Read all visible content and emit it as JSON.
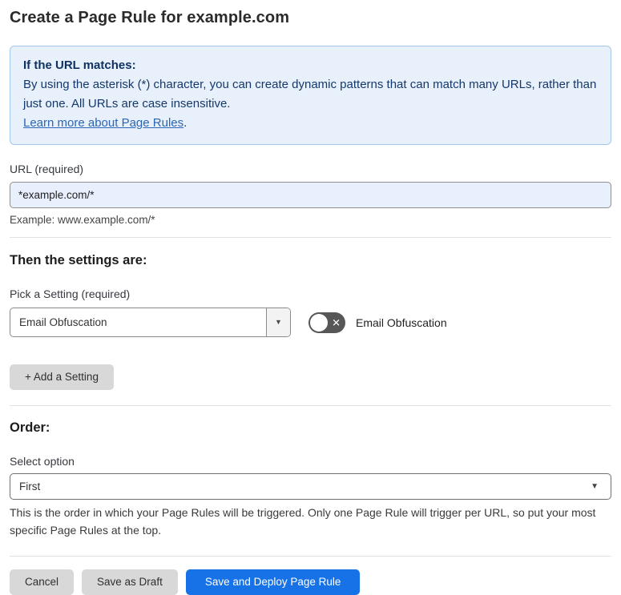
{
  "page": {
    "title": "Create a Page Rule for example.com"
  },
  "info_box": {
    "heading": "If the URL matches:",
    "body": "By using the asterisk (*) character, you can create dynamic patterns that can match many URLs, rather than just one. All URLs are case insensitive.",
    "link_label": "Learn more about Page Rules",
    "link_suffix": "."
  },
  "url_section": {
    "label": "URL (required)",
    "value": "*example.com/*",
    "example": "Example: www.example.com/*"
  },
  "settings_section": {
    "heading": "Then the settings are:",
    "picker_label": "Pick a Setting (required)",
    "selected_setting": "Email Obfuscation",
    "toggle_label": "Email Obfuscation",
    "toggle_state": "off",
    "add_setting_label": "+ Add a Setting"
  },
  "order_section": {
    "heading": "Order:",
    "select_label": "Select option",
    "selected_option": "First",
    "help_text": "This is the order in which your Page Rules will be triggered. Only one Page Rule will trigger per URL, so put your most specific Page Rules at the top."
  },
  "footer": {
    "cancel_label": "Cancel",
    "save_draft_label": "Save as Draft",
    "save_deploy_label": "Save and Deploy Page Rule"
  },
  "icons": {
    "dropdown_arrow": "▼",
    "toggle_x": "✕"
  },
  "colors": {
    "accent_blue": "#1672e6",
    "info_bg": "#e8f1fb",
    "info_border": "#a3c7e8",
    "info_text": "#14386b",
    "link_blue": "#2b65b5",
    "input_bg": "#e8f0fe",
    "toggle_off_bg": "#575757",
    "button_gray": "#d8d8d8"
  }
}
